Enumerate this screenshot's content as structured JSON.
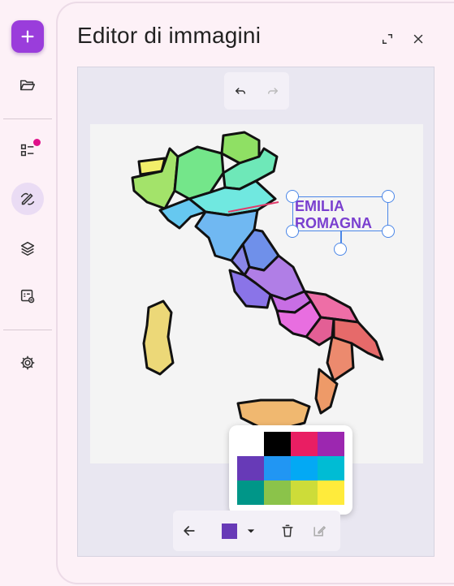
{
  "rail": {
    "items": [
      {
        "name": "add",
        "icon": "plus-icon"
      },
      {
        "name": "open",
        "icon": "folder-open-icon"
      },
      {
        "name": "checklist",
        "icon": "checklist-icon",
        "badge": true
      },
      {
        "name": "draw",
        "icon": "draw-icon",
        "active": true
      },
      {
        "name": "layers",
        "icon": "layers-icon"
      },
      {
        "name": "media",
        "icon": "image-link-icon"
      },
      {
        "name": "settings",
        "icon": "gear-icon"
      }
    ],
    "accent": "#9a3ddb",
    "badge_color": "#e0118a"
  },
  "panel": {
    "title": "Editor di immagini",
    "expand_icon": "expand-icon",
    "close_icon": "close-icon"
  },
  "canvas": {
    "undo_icon": "undo-icon",
    "redo_icon": "redo-icon",
    "annotation": {
      "line1": "EMILIA",
      "line2": "ROMAGNA",
      "color": "#7a3fcf"
    }
  },
  "palette": {
    "colors": [
      "#ffffff",
      "#000000",
      "#e91e63",
      "#9c27b0",
      "#673ab7",
      "#2196f3",
      "#03a9f4",
      "#00bcd4",
      "#009688",
      "#8bc34a",
      "#cddc39",
      "#ffeb3b"
    ]
  },
  "toolbar": {
    "back_icon": "arrow-left-icon",
    "current_color": "#673ab7",
    "dropdown_icon": "caret-down-icon",
    "delete_icon": "trash-icon",
    "edit_icon": "edit-icon"
  }
}
